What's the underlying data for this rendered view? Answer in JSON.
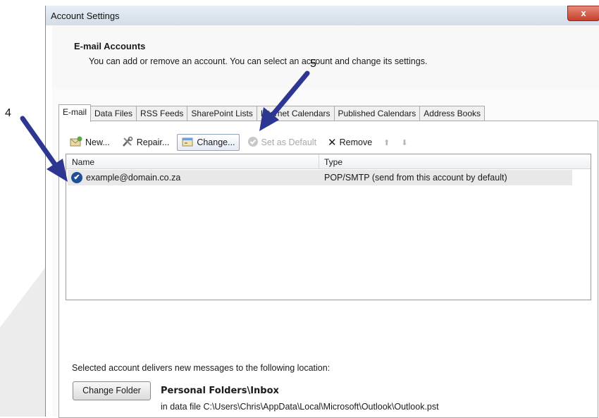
{
  "window": {
    "title": "Account Settings",
    "close_glyph": "x"
  },
  "header": {
    "title": "E-mail Accounts",
    "description": "You can add or remove an account. You can select an account and change its settings."
  },
  "tabs": [
    {
      "label": "E-mail",
      "active": true
    },
    {
      "label": "Data Files",
      "active": false
    },
    {
      "label": "RSS Feeds",
      "active": false
    },
    {
      "label": "SharePoint Lists",
      "active": false
    },
    {
      "label": "Internet Calendars",
      "active": false
    },
    {
      "label": "Published Calendars",
      "active": false
    },
    {
      "label": "Address Books",
      "active": false
    }
  ],
  "toolbar": {
    "new_label": "New...",
    "repair_label": "Repair...",
    "change_label": "Change...",
    "set_default_label": "Set as Default",
    "remove_label": "Remove",
    "remove_glyph": "✕",
    "up_glyph": "⬆",
    "down_glyph": "⬇"
  },
  "list": {
    "columns": {
      "name": "Name",
      "type": "Type"
    },
    "rows": [
      {
        "name": "example@domain.co.za",
        "type": "POP/SMTP (send from this account by default)",
        "default": true,
        "check_glyph": "✔"
      }
    ]
  },
  "location": {
    "description": "Selected account delivers new messages to the following location:",
    "change_folder_label": "Change Folder",
    "folder_name": "Personal Folders\\Inbox",
    "data_file": "in data file C:\\Users\\Chris\\AppData\\Local\\Microsoft\\Outlook\\Outlook.pst"
  },
  "annotations": {
    "step_4": "4",
    "step_5": "5",
    "arrow_color": "#2d3691"
  },
  "colors": {
    "selected_row": "#e8e8e8",
    "default_check": "#1f4e9a",
    "close_button": "#c4402b"
  }
}
